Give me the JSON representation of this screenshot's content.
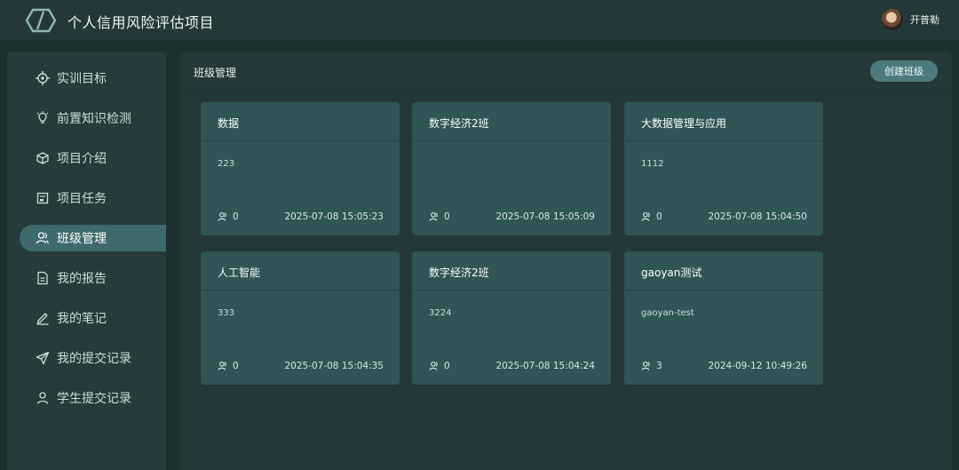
{
  "header": {
    "title": "个人信用风险评估项目",
    "user_name": "开普勒",
    "logo_icon": "hexagon-slash-logo",
    "avatar_icon": "user-avatar-portrait"
  },
  "sidebar": {
    "items": [
      {
        "label": "实训目标",
        "icon": "target-icon",
        "active": false
      },
      {
        "label": "前置知识检测",
        "icon": "bulb-icon",
        "active": false
      },
      {
        "label": "项目介绍",
        "icon": "cube-icon",
        "active": false
      },
      {
        "label": "项目任务",
        "icon": "task-icon",
        "active": false
      },
      {
        "label": "班级管理",
        "icon": "users-icon",
        "active": true
      },
      {
        "label": "我的报告",
        "icon": "document-icon",
        "active": false
      },
      {
        "label": "我的笔记",
        "icon": "pen-icon",
        "active": false
      },
      {
        "label": "我的提交记录",
        "icon": "send-icon",
        "active": false
      },
      {
        "label": "学生提交记录",
        "icon": "user-icon",
        "active": false
      }
    ]
  },
  "main": {
    "title": "班级管理",
    "create_button": "创建班级",
    "cards": [
      {
        "name": "数据",
        "desc": "223",
        "count": "0",
        "time": "2025-07-08 15:05:23"
      },
      {
        "name": "数字经济2班",
        "desc": "",
        "count": "0",
        "time": "2025-07-08 15:05:09"
      },
      {
        "name": "大数据管理与应用",
        "desc": "1112",
        "count": "0",
        "time": "2025-07-08 15:04:50"
      },
      {
        "name": "人工智能",
        "desc": "333",
        "count": "0",
        "time": "2025-07-08 15:04:35"
      },
      {
        "name": "数字经济2班",
        "desc": "3224",
        "count": "0",
        "time": "2025-07-08 15:04:24"
      },
      {
        "name": "gaoyan测试",
        "desc": "gaoyan-test",
        "count": "3",
        "time": "2024-09-12 10:49:26"
      }
    ]
  },
  "colors": {
    "background": "#1c3030",
    "panel": "#243839",
    "card": "#2f5556",
    "active_nav": "#3f6a6c",
    "button": "#4d7b7d"
  }
}
